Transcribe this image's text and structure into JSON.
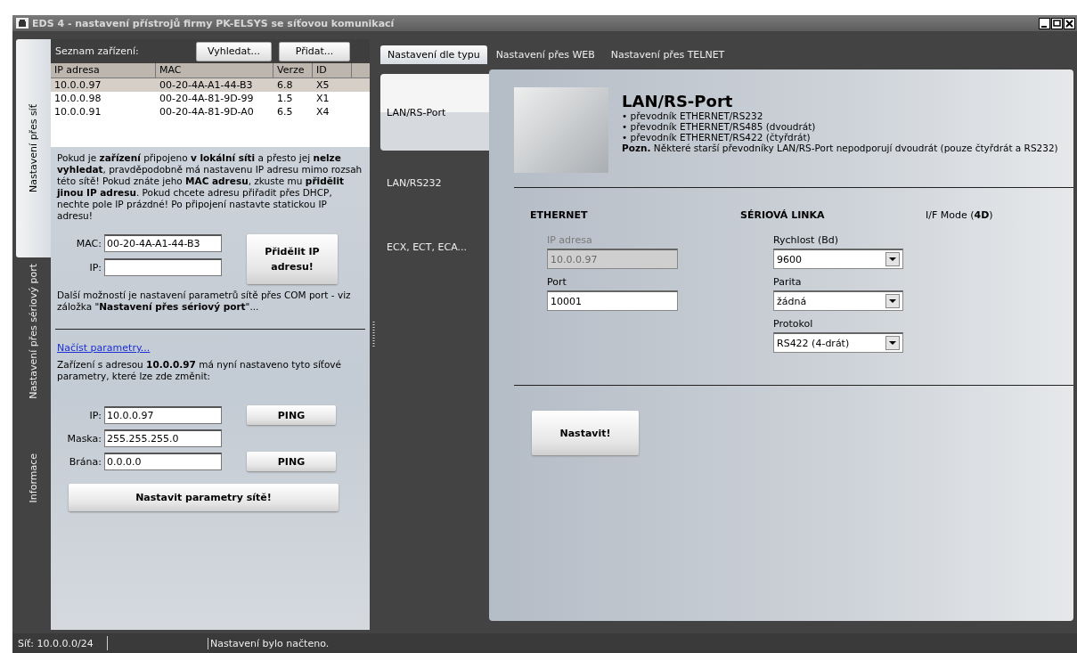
{
  "window": {
    "title": "EDS 4 - nastavení přístrojů firmy PK-ELSYS se síťovou komunikací"
  },
  "side_tabs": [
    {
      "label": "Nastavení přes síť",
      "selected": true
    },
    {
      "label": "Nastavení přes sériový port",
      "selected": false
    },
    {
      "label": "Informace",
      "selected": false
    }
  ],
  "device_list": {
    "label": "Seznam zařízení:",
    "buttons": [
      "Vyhledat...",
      "Přidat..."
    ],
    "columns": [
      "IP adresa",
      "MAC",
      "Verze",
      "ID"
    ],
    "rows": [
      {
        "cells": [
          "10.0.0.97",
          "00-20-4A-A1-44-B3",
          "6.8",
          "X5"
        ],
        "selected": true
      },
      {
        "cells": [
          "10.0.0.98",
          "00-20-4A-81-9D-99",
          "1.5",
          "X1"
        ],
        "selected": false
      },
      {
        "cells": [
          "10.0.0.91",
          "00-20-4A-81-9D-A0",
          "6.5",
          "X4"
        ],
        "selected": false
      }
    ]
  },
  "info_text": "Pokud je **zařízení** připojeno **v lokální síti** a přesto jej **nelze vyhledat**, pravděpodobně má nastavenu IP adresu mimo rozsah této sítě! Pokud znáte jeho **MAC adresu**, zkuste mu **přidělit jinou IP adresu**. Pokud chcete adresu přiřadit přes DHCP, nechte pole IP prázdné! Po připojení nastavte statickou IP adresu!",
  "assign_form": {
    "fields": [
      {
        "label": "MAC:",
        "value": "00-20-4A-A1-44-B3"
      },
      {
        "label": "IP:"
      }
    ],
    "button": "Přidělit IP adresu!"
  },
  "com_note": "Další možností je nastavení parametrů sítě přes COM port - viz záložka \"**Nastavení přes sériový port**\"...",
  "load_link": "Načíst parametry...",
  "current_text": "Zařízení s adresou **10.0.0.97** má nyní nastaveno tyto síťové parametry, které lze zde změnit:",
  "net_fields": [
    {
      "label": "IP:",
      "value": "10.0.0.97",
      "button": "PING"
    },
    {
      "label": "Maska:",
      "value": "255.255.255.0"
    },
    {
      "label": "Brána:",
      "value": "0.0.0.0",
      "button": "PING"
    }
  ],
  "apply_button": "Nastavit parametry sítě!",
  "type_tabs": [
    {
      "label": "Nastavení dle typu",
      "selected": true
    },
    {
      "label": "Nastavení přes WEB",
      "selected": false
    },
    {
      "label": "Nastavení přes TELNET",
      "selected": false
    }
  ],
  "device_types": [
    {
      "label": "LAN/RS-Port",
      "selected": true
    },
    {
      "label": "LAN/RS232",
      "selected": false
    },
    {
      "label": "ECX, ECT, ECA...",
      "selected": false
    }
  ],
  "device": {
    "title": "LAN/RS-Port",
    "bullets": [
      "• převodník ETHERNET/RS232",
      "• převodník ETHERNET/RS485 (dvoudrát)",
      "• převodník ETHERNET/RS422 (čtyřdrát)"
    ],
    "note": "**Pozn.** Některé starší převodníky LAN/RS-Port nepodporují dvoudrát (pouze čtyřdrát a RS232)"
  },
  "ethernet": {
    "heading": "ETHERNET",
    "fields": [
      {
        "label": "IP adresa",
        "value": "10.0.0.97",
        "disabled": true
      },
      {
        "label": "Port",
        "value": "10001",
        "disabled": false
      }
    ]
  },
  "serial": {
    "heading": "SÉRIOVÁ LINKA",
    "selects": [
      {
        "label": "Rychlost (Bd)",
        "value": "9600"
      },
      {
        "label": "Parita",
        "value": "žádná"
      },
      {
        "label": "Protokol",
        "value": "RS422 (4-drát)"
      }
    ]
  },
  "if_mode": "I/F Mode (**4D**)",
  "set_button": "Nastavit!",
  "status_bar": [
    "Síť: 10.0.0.0/24",
    "Nastavení bylo načteno."
  ]
}
